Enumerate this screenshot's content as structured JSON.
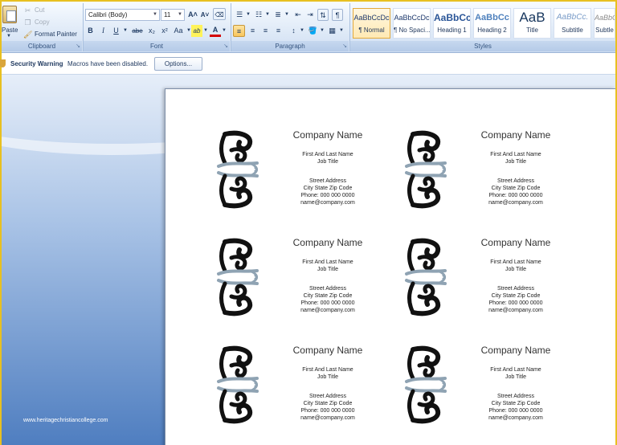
{
  "ribbon": {
    "clipboard": {
      "paste_label": "Paste",
      "cut_label": "Cut",
      "copy_label": "Copy",
      "format_painter_label": "Format Painter",
      "group_label": "Clipboard"
    },
    "font": {
      "font_name": "Calibri (Body)",
      "font_size": "11",
      "grow_label": "A˄",
      "shrink_label": "A˅",
      "bold_label": "B",
      "italic_label": "I",
      "underline_label": "U",
      "strike_label": "abe",
      "subscript_label": "x₂",
      "superscript_label": "x²",
      "case_label": "Aa",
      "highlight_label": "ab",
      "color_label": "A",
      "group_label": "Font"
    },
    "paragraph": {
      "group_label": "Paragraph"
    },
    "styles": {
      "group_label": "Styles",
      "tiles": [
        {
          "preview": "AaBbCcDc",
          "name": "¶ Normal"
        },
        {
          "preview": "AaBbCcDc",
          "name": "¶ No Spaci..."
        },
        {
          "preview": "AaBbCc",
          "name": "Heading 1"
        },
        {
          "preview": "AaBbCc",
          "name": "Heading 2"
        },
        {
          "preview": "AaB",
          "name": "Title"
        },
        {
          "preview": "AaBbCc.",
          "name": "Subtitle"
        },
        {
          "preview": "AaBbC",
          "name": "Subtle"
        }
      ]
    }
  },
  "security_bar": {
    "title": "Security Warning",
    "message": "Macros have been disabled.",
    "options_label": "Options..."
  },
  "colors": {
    "ornament_dark": "#111111",
    "ornament_accent": "#8fa3b3"
  },
  "cards": [
    {
      "company": "Company Name",
      "name": "First And Last Name",
      "job_title": "Job Title",
      "street": "Street Address",
      "city": "City State Zip Code",
      "phone": "Phone: 000 000 0000",
      "email": "name@company.com"
    },
    {
      "company": "Company Name",
      "name": "First And Last Name",
      "job_title": "Job Title",
      "street": "Street Address",
      "city": "City State Zip Code",
      "phone": "Phone: 000 000 0000",
      "email": "name@company.com"
    },
    {
      "company": "Company Name",
      "name": "First And Last Name",
      "job_title": "Job Title",
      "street": "Street Address",
      "city": "City State Zip Code",
      "phone": "Phone: 000 000 0000",
      "email": "name@company.com"
    },
    {
      "company": "Company Name",
      "name": "First And Last Name",
      "job_title": "Job Title",
      "street": "Street Address",
      "city": "City State Zip Code",
      "phone": "Phone: 000 000 0000",
      "email": "name@company.com"
    },
    {
      "company": "Company Name",
      "name": "First And Last Name",
      "job_title": "Job Title",
      "street": "Street Address",
      "city": "City State Zip Code",
      "phone": "Phone: 000 000 0000",
      "email": "name@company.com"
    },
    {
      "company": "Company Name",
      "name": "First And Last Name",
      "job_title": "Job Title",
      "street": "Street Address",
      "city": "City State Zip Code",
      "phone": "Phone: 000 000 0000",
      "email": "name@company.com"
    }
  ],
  "watermark": "www.heritagechristiancollege.com"
}
